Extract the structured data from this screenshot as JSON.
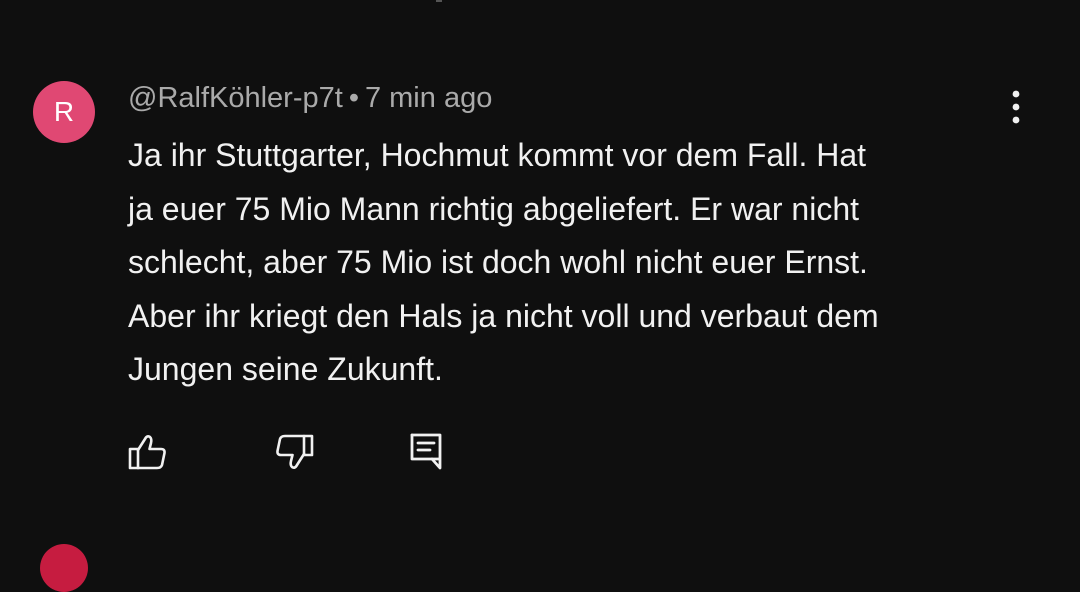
{
  "comment": {
    "avatar_letter": "R",
    "avatar_color": "#e04873",
    "author": "@RalfKöhler-p7t",
    "separator": "•",
    "time": "7 min ago",
    "lines": [
      "Ja ihr Stuttgarter, Hochmut kommt vor dem Fall. Hat",
      "ja euer 75 Mio Mann richtig abgeliefert. Er war nicht",
      "schlecht, aber 75 Mio ist doch wohl nicht euer Ernst.",
      "Aber ihr kriegt den Hals ja nicht voll und verbaut dem",
      "Jungen seine Zukunft."
    ]
  },
  "actions": {
    "like_icon": "thumbs-up-icon",
    "dislike_icon": "thumbs-down-icon",
    "reply_icon": "reply-icon",
    "menu_icon": "more-vertical-icon"
  },
  "colors": {
    "background": "#0f0f0f",
    "text": "#f1f1f1",
    "meta": "#aaaaaa"
  }
}
